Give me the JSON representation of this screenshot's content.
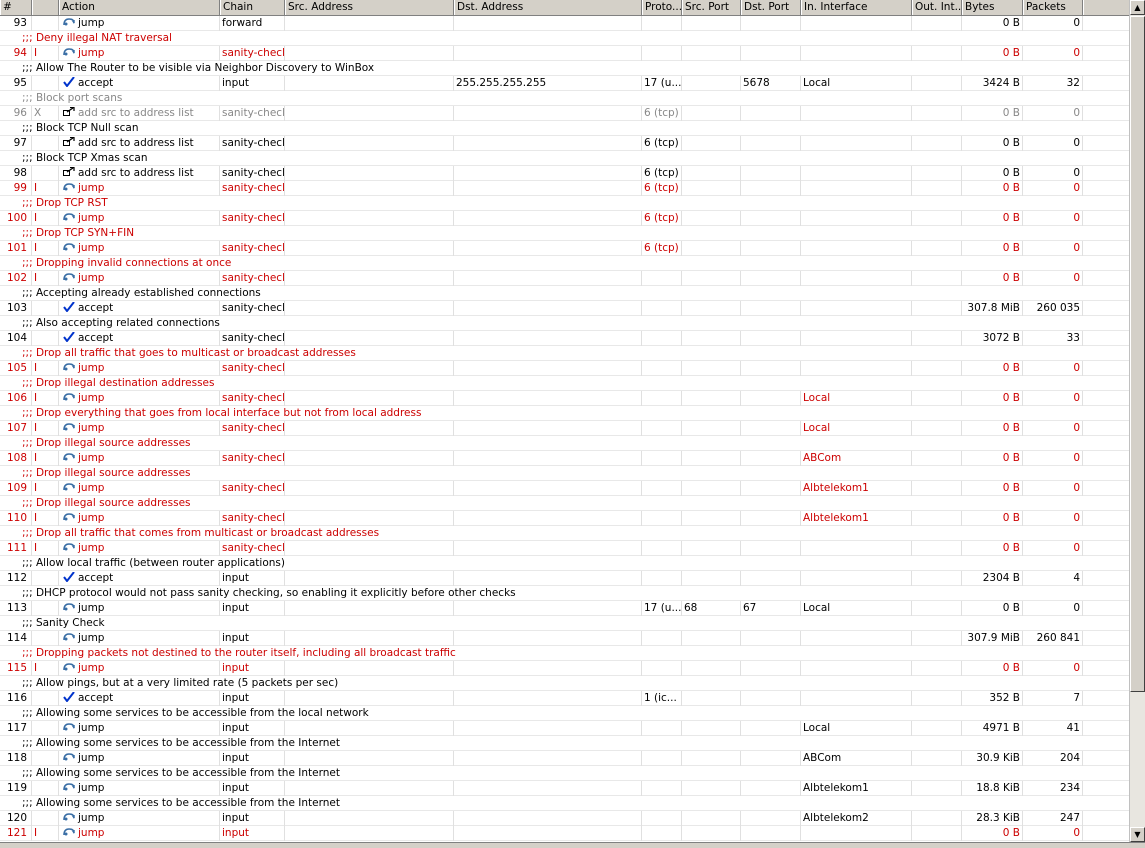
{
  "columns": [
    "#",
    "",
    "Action",
    "Chain",
    "Src. Address",
    "Dst. Address",
    "Proto...",
    "Src. Port",
    "Dst. Port",
    "In. Interface",
    "Out. Int...",
    "Bytes",
    "Packets"
  ],
  "rows": [
    {
      "kind": "rule",
      "num": "93",
      "flag": "",
      "icon": "jump",
      "action": "jump",
      "chain": "forward",
      "src": "",
      "dst": "",
      "proto": "",
      "sport": "",
      "dport": "",
      "inif": "",
      "outif": "",
      "bytes": "0 B",
      "packets": "0",
      "red": false,
      "gray": false
    },
    {
      "kind": "comment",
      "text": ";;; Deny illegal NAT traversal",
      "red": true,
      "gray": false
    },
    {
      "kind": "rule",
      "num": "94",
      "flag": "I",
      "icon": "jump",
      "action": "jump",
      "chain": "sanity-check",
      "src": "",
      "dst": "",
      "proto": "",
      "sport": "",
      "dport": "",
      "inif": "",
      "outif": "",
      "bytes": "0 B",
      "packets": "0",
      "red": true,
      "gray": false
    },
    {
      "kind": "comment",
      "text": ";;; Allow The Router to be visible via Neighbor Discovery to WinBox",
      "red": false,
      "gray": false
    },
    {
      "kind": "rule",
      "num": "95",
      "flag": "",
      "icon": "accept",
      "action": "accept",
      "chain": "input",
      "src": "",
      "dst": "255.255.255.255",
      "proto": "17 (u...",
      "sport": "",
      "dport": "5678",
      "inif": "Local",
      "outif": "",
      "bytes": "3424 B",
      "packets": "32",
      "red": false,
      "gray": false
    },
    {
      "kind": "comment",
      "text": ";;; Block port scans",
      "red": false,
      "gray": true
    },
    {
      "kind": "rule",
      "num": "96",
      "flag": "X",
      "icon": "addsrc",
      "action": "add src to address list",
      "chain": "sanity-check",
      "src": "",
      "dst": "",
      "proto": "6 (tcp)",
      "sport": "",
      "dport": "",
      "inif": "",
      "outif": "",
      "bytes": "0 B",
      "packets": "0",
      "red": false,
      "gray": true
    },
    {
      "kind": "comment",
      "text": ";;; Block TCP Null scan",
      "red": false,
      "gray": false
    },
    {
      "kind": "rule",
      "num": "97",
      "flag": "",
      "icon": "addsrc",
      "action": "add src to address list",
      "chain": "sanity-check",
      "src": "",
      "dst": "",
      "proto": "6 (tcp)",
      "sport": "",
      "dport": "",
      "inif": "",
      "outif": "",
      "bytes": "0 B",
      "packets": "0",
      "red": false,
      "gray": false
    },
    {
      "kind": "comment",
      "text": ";;; Block TCP Xmas scan",
      "red": false,
      "gray": false
    },
    {
      "kind": "rule",
      "num": "98",
      "flag": "",
      "icon": "addsrc",
      "action": "add src to address list",
      "chain": "sanity-check",
      "src": "",
      "dst": "",
      "proto": "6 (tcp)",
      "sport": "",
      "dport": "",
      "inif": "",
      "outif": "",
      "bytes": "0 B",
      "packets": "0",
      "red": false,
      "gray": false
    },
    {
      "kind": "rule",
      "num": "99",
      "flag": "I",
      "icon": "jump",
      "action": "jump",
      "chain": "sanity-check",
      "src": "",
      "dst": "",
      "proto": "6 (tcp)",
      "sport": "",
      "dport": "",
      "inif": "",
      "outif": "",
      "bytes": "0 B",
      "packets": "0",
      "red": true,
      "gray": false
    },
    {
      "kind": "comment",
      "text": ";;; Drop TCP RST",
      "red": true,
      "gray": false
    },
    {
      "kind": "rule",
      "num": "100",
      "flag": "I",
      "icon": "jump",
      "action": "jump",
      "chain": "sanity-check",
      "src": "",
      "dst": "",
      "proto": "6 (tcp)",
      "sport": "",
      "dport": "",
      "inif": "",
      "outif": "",
      "bytes": "0 B",
      "packets": "0",
      "red": true,
      "gray": false
    },
    {
      "kind": "comment",
      "text": ";;; Drop TCP SYN+FIN",
      "red": true,
      "gray": false
    },
    {
      "kind": "rule",
      "num": "101",
      "flag": "I",
      "icon": "jump",
      "action": "jump",
      "chain": "sanity-check",
      "src": "",
      "dst": "",
      "proto": "6 (tcp)",
      "sport": "",
      "dport": "",
      "inif": "",
      "outif": "",
      "bytes": "0 B",
      "packets": "0",
      "red": true,
      "gray": false
    },
    {
      "kind": "comment",
      "text": ";;; Dropping invalid connections at once",
      "red": true,
      "gray": false
    },
    {
      "kind": "rule",
      "num": "102",
      "flag": "I",
      "icon": "jump",
      "action": "jump",
      "chain": "sanity-check",
      "src": "",
      "dst": "",
      "proto": "",
      "sport": "",
      "dport": "",
      "inif": "",
      "outif": "",
      "bytes": "0 B",
      "packets": "0",
      "red": true,
      "gray": false
    },
    {
      "kind": "comment",
      "text": ";;; Accepting already established connections",
      "red": false,
      "gray": false
    },
    {
      "kind": "rule",
      "num": "103",
      "flag": "",
      "icon": "accept",
      "action": "accept",
      "chain": "sanity-check",
      "src": "",
      "dst": "",
      "proto": "",
      "sport": "",
      "dport": "",
      "inif": "",
      "outif": "",
      "bytes": "307.8 MiB",
      "packets": "260 035",
      "red": false,
      "gray": false
    },
    {
      "kind": "comment",
      "text": ";;; Also accepting related connections",
      "red": false,
      "gray": false
    },
    {
      "kind": "rule",
      "num": "104",
      "flag": "",
      "icon": "accept",
      "action": "accept",
      "chain": "sanity-check",
      "src": "",
      "dst": "",
      "proto": "",
      "sport": "",
      "dport": "",
      "inif": "",
      "outif": "",
      "bytes": "3072 B",
      "packets": "33",
      "red": false,
      "gray": false
    },
    {
      "kind": "comment",
      "text": ";;; Drop all traffic that goes to multicast or broadcast addresses",
      "red": true,
      "gray": false
    },
    {
      "kind": "rule",
      "num": "105",
      "flag": "I",
      "icon": "jump",
      "action": "jump",
      "chain": "sanity-check",
      "src": "",
      "dst": "",
      "proto": "",
      "sport": "",
      "dport": "",
      "inif": "",
      "outif": "",
      "bytes": "0 B",
      "packets": "0",
      "red": true,
      "gray": false
    },
    {
      "kind": "comment",
      "text": ";;; Drop illegal destination addresses",
      "red": true,
      "gray": false
    },
    {
      "kind": "rule",
      "num": "106",
      "flag": "I",
      "icon": "jump",
      "action": "jump",
      "chain": "sanity-check",
      "src": "",
      "dst": "",
      "proto": "",
      "sport": "",
      "dport": "",
      "inif": "Local",
      "outif": "",
      "bytes": "0 B",
      "packets": "0",
      "red": true,
      "gray": false
    },
    {
      "kind": "comment",
      "text": ";;; Drop everything that goes from local interface but not from local address",
      "red": true,
      "gray": false
    },
    {
      "kind": "rule",
      "num": "107",
      "flag": "I",
      "icon": "jump",
      "action": "jump",
      "chain": "sanity-check",
      "src": "",
      "dst": "",
      "proto": "",
      "sport": "",
      "dport": "",
      "inif": "Local",
      "outif": "",
      "bytes": "0 B",
      "packets": "0",
      "red": true,
      "gray": false
    },
    {
      "kind": "comment",
      "text": ";;; Drop illegal source addresses",
      "red": true,
      "gray": false
    },
    {
      "kind": "rule",
      "num": "108",
      "flag": "I",
      "icon": "jump",
      "action": "jump",
      "chain": "sanity-check",
      "src": "",
      "dst": "",
      "proto": "",
      "sport": "",
      "dport": "",
      "inif": "ABCom",
      "outif": "",
      "bytes": "0 B",
      "packets": "0",
      "red": true,
      "gray": false
    },
    {
      "kind": "comment",
      "text": ";;; Drop illegal source addresses",
      "red": true,
      "gray": false
    },
    {
      "kind": "rule",
      "num": "109",
      "flag": "I",
      "icon": "jump",
      "action": "jump",
      "chain": "sanity-check",
      "src": "",
      "dst": "",
      "proto": "",
      "sport": "",
      "dport": "",
      "inif": "Albtelekom1",
      "outif": "",
      "bytes": "0 B",
      "packets": "0",
      "red": true,
      "gray": false
    },
    {
      "kind": "comment",
      "text": ";;; Drop illegal source addresses",
      "red": true,
      "gray": false
    },
    {
      "kind": "rule",
      "num": "110",
      "flag": "I",
      "icon": "jump",
      "action": "jump",
      "chain": "sanity-check",
      "src": "",
      "dst": "",
      "proto": "",
      "sport": "",
      "dport": "",
      "inif": "Albtelekom1",
      "outif": "",
      "bytes": "0 B",
      "packets": "0",
      "red": true,
      "gray": false
    },
    {
      "kind": "comment",
      "text": ";;; Drop all traffic that comes from multicast or broadcast addresses",
      "red": true,
      "gray": false
    },
    {
      "kind": "rule",
      "num": "111",
      "flag": "I",
      "icon": "jump",
      "action": "jump",
      "chain": "sanity-check",
      "src": "",
      "dst": "",
      "proto": "",
      "sport": "",
      "dport": "",
      "inif": "",
      "outif": "",
      "bytes": "0 B",
      "packets": "0",
      "red": true,
      "gray": false
    },
    {
      "kind": "comment",
      "text": ";;; Allow local traffic (between router applications)",
      "red": false,
      "gray": false
    },
    {
      "kind": "rule",
      "num": "112",
      "flag": "",
      "icon": "accept",
      "action": "accept",
      "chain": "input",
      "src": "",
      "dst": "",
      "proto": "",
      "sport": "",
      "dport": "",
      "inif": "",
      "outif": "",
      "bytes": "2304 B",
      "packets": "4",
      "red": false,
      "gray": false
    },
    {
      "kind": "comment",
      "text": ";;; DHCP protocol would not pass sanity checking, so enabling it explicitly before other checks",
      "red": false,
      "gray": false
    },
    {
      "kind": "rule",
      "num": "113",
      "flag": "",
      "icon": "jump",
      "action": "jump",
      "chain": "input",
      "src": "",
      "dst": "",
      "proto": "17 (u...",
      "sport": "68",
      "dport": "67",
      "inif": "Local",
      "outif": "",
      "bytes": "0 B",
      "packets": "0",
      "red": false,
      "gray": false
    },
    {
      "kind": "comment",
      "text": ";;; Sanity Check",
      "red": false,
      "gray": false
    },
    {
      "kind": "rule",
      "num": "114",
      "flag": "",
      "icon": "jump",
      "action": "jump",
      "chain": "input",
      "src": "",
      "dst": "",
      "proto": "",
      "sport": "",
      "dport": "",
      "inif": "",
      "outif": "",
      "bytes": "307.9 MiB",
      "packets": "260 841",
      "red": false,
      "gray": false
    },
    {
      "kind": "comment",
      "text": ";;; Dropping packets not destined to the router itself, including all broadcast traffic",
      "red": true,
      "gray": false
    },
    {
      "kind": "rule",
      "num": "115",
      "flag": "I",
      "icon": "jump",
      "action": "jump",
      "chain": "input",
      "src": "",
      "dst": "",
      "proto": "",
      "sport": "",
      "dport": "",
      "inif": "",
      "outif": "",
      "bytes": "0 B",
      "packets": "0",
      "red": true,
      "gray": false
    },
    {
      "kind": "comment",
      "text": ";;; Allow pings, but at a very limited rate (5 packets per sec)",
      "red": false,
      "gray": false
    },
    {
      "kind": "rule",
      "num": "116",
      "flag": "",
      "icon": "accept",
      "action": "accept",
      "chain": "input",
      "src": "",
      "dst": "",
      "proto": "1 (ic...",
      "sport": "",
      "dport": "",
      "inif": "",
      "outif": "",
      "bytes": "352 B",
      "packets": "7",
      "red": false,
      "gray": false
    },
    {
      "kind": "comment",
      "text": ";;; Allowing some services to be accessible from the local network",
      "red": false,
      "gray": false
    },
    {
      "kind": "rule",
      "num": "117",
      "flag": "",
      "icon": "jump",
      "action": "jump",
      "chain": "input",
      "src": "",
      "dst": "",
      "proto": "",
      "sport": "",
      "dport": "",
      "inif": "Local",
      "outif": "",
      "bytes": "4971 B",
      "packets": "41",
      "red": false,
      "gray": false
    },
    {
      "kind": "comment",
      "text": ";;; Allowing some services to be accessible from the Internet",
      "red": false,
      "gray": false
    },
    {
      "kind": "rule",
      "num": "118",
      "flag": "",
      "icon": "jump",
      "action": "jump",
      "chain": "input",
      "src": "",
      "dst": "",
      "proto": "",
      "sport": "",
      "dport": "",
      "inif": "ABCom",
      "outif": "",
      "bytes": "30.9 KiB",
      "packets": "204",
      "red": false,
      "gray": false
    },
    {
      "kind": "comment",
      "text": ";;; Allowing some services to be accessible from the Internet",
      "red": false,
      "gray": false
    },
    {
      "kind": "rule",
      "num": "119",
      "flag": "",
      "icon": "jump",
      "action": "jump",
      "chain": "input",
      "src": "",
      "dst": "",
      "proto": "",
      "sport": "",
      "dport": "",
      "inif": "Albtelekom1",
      "outif": "",
      "bytes": "18.8 KiB",
      "packets": "234",
      "red": false,
      "gray": false
    },
    {
      "kind": "comment",
      "text": ";;; Allowing some services to be accessible from the Internet",
      "red": false,
      "gray": false
    },
    {
      "kind": "rule",
      "num": "120",
      "flag": "",
      "icon": "jump",
      "action": "jump",
      "chain": "input",
      "src": "",
      "dst": "",
      "proto": "",
      "sport": "",
      "dport": "",
      "inif": "Albtelekom2",
      "outif": "",
      "bytes": "28.3 KiB",
      "packets": "247",
      "red": false,
      "gray": false
    },
    {
      "kind": "rule",
      "num": "121",
      "flag": "I",
      "icon": "jump",
      "action": "jump",
      "chain": "input",
      "src": "",
      "dst": "",
      "proto": "",
      "sport": "",
      "dport": "",
      "inif": "",
      "outif": "",
      "bytes": "0 B",
      "packets": "0",
      "red": true,
      "gray": false
    }
  ],
  "colors": {
    "disabled_red": "#cc0000",
    "accept_check": "#0033cc",
    "jump_icon": "#3a6ea5"
  }
}
